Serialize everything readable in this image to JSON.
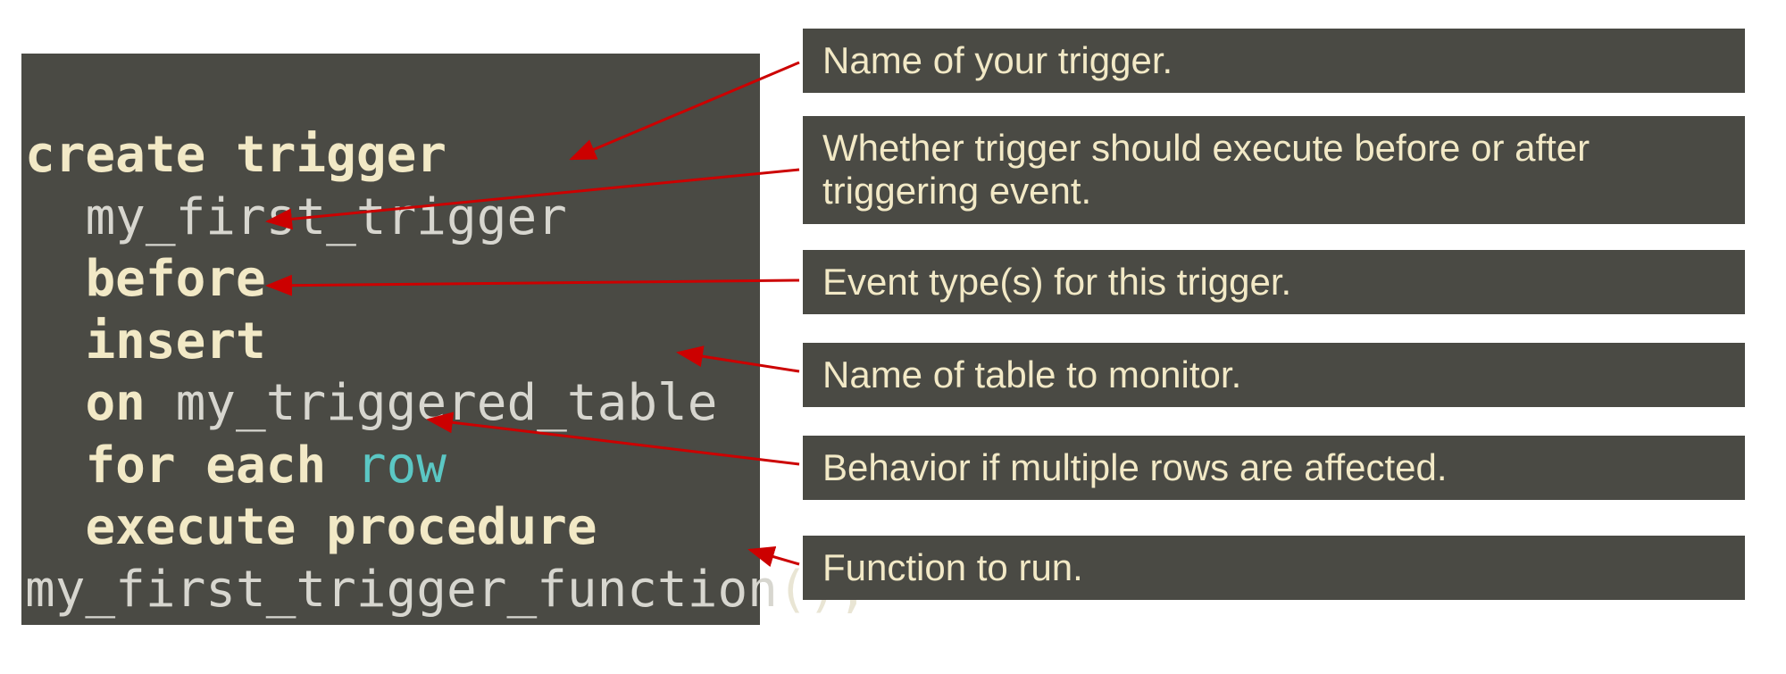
{
  "code": {
    "line1_kw": "create trigger",
    "line2_ident": "my_first_trigger",
    "line3_kw": "before",
    "line4_kw": "insert",
    "line5_kw": "on",
    "line5_ident": "my_triggered_table",
    "line6_kw": "for each",
    "line6_row": "row",
    "line7_kw": "execute procedure",
    "line8_ident": "my_first_trigger_function",
    "line8_punct": "();"
  },
  "callouts": {
    "c1": "Name of your trigger.",
    "c2": "Whether trigger should execute before or after triggering event.",
    "c3": "Event type(s) for this trigger.",
    "c4": "Name of table to monitor.",
    "c5": "Behavior if multiple rows are affected.",
    "c6": "Function to run."
  }
}
